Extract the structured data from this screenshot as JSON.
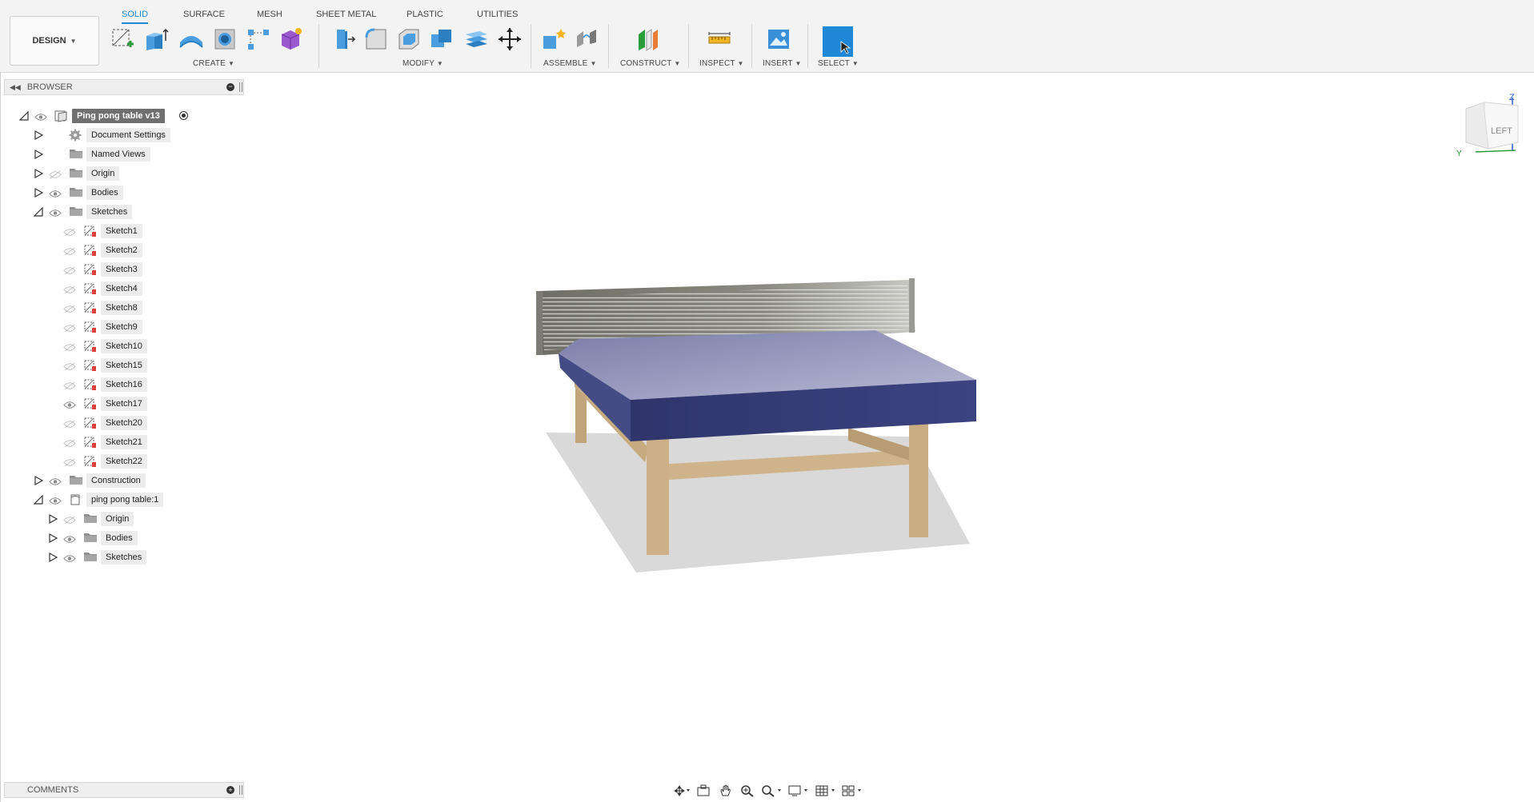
{
  "workspace": {
    "label": "DESIGN"
  },
  "tabs": [
    {
      "label": "SOLID",
      "active": true
    },
    {
      "label": "SURFACE"
    },
    {
      "label": "MESH"
    },
    {
      "label": "SHEET METAL"
    },
    {
      "label": "PLASTIC"
    },
    {
      "label": "UTILITIES"
    }
  ],
  "groups": {
    "create": "CREATE",
    "modify": "MODIFY",
    "assemble": "ASSEMBLE",
    "construct": "CONSTRUCT",
    "inspect": "INSPECT",
    "insert": "INSERT",
    "select": "SELECT"
  },
  "browser": {
    "title": "BROWSER",
    "root": "Ping pong table v13",
    "items": [
      "Document Settings",
      "Named Views",
      "Origin",
      "Bodies",
      "Sketches",
      "Sketch1",
      "Sketch2",
      "Sketch3",
      "Sketch4",
      "Sketch8",
      "Sketch9",
      "Sketch10",
      "Sketch15",
      "Sketch16",
      "Sketch17",
      "Sketch20",
      "Sketch21",
      "Sketch22",
      "Construction",
      "ping pong table:1",
      "Origin",
      "Bodies",
      "Sketches"
    ]
  },
  "comments": {
    "title": "COMMENTS"
  },
  "viewcube": {
    "face": "LEFT",
    "axis_z": "Z",
    "axis_y": "Y"
  },
  "colors": {
    "accent": "#1e88d6",
    "table_top": "#5a5f93",
    "table_side": "#343a73",
    "wood": "#c9ad85",
    "sketch_marker": "#d9413b"
  }
}
